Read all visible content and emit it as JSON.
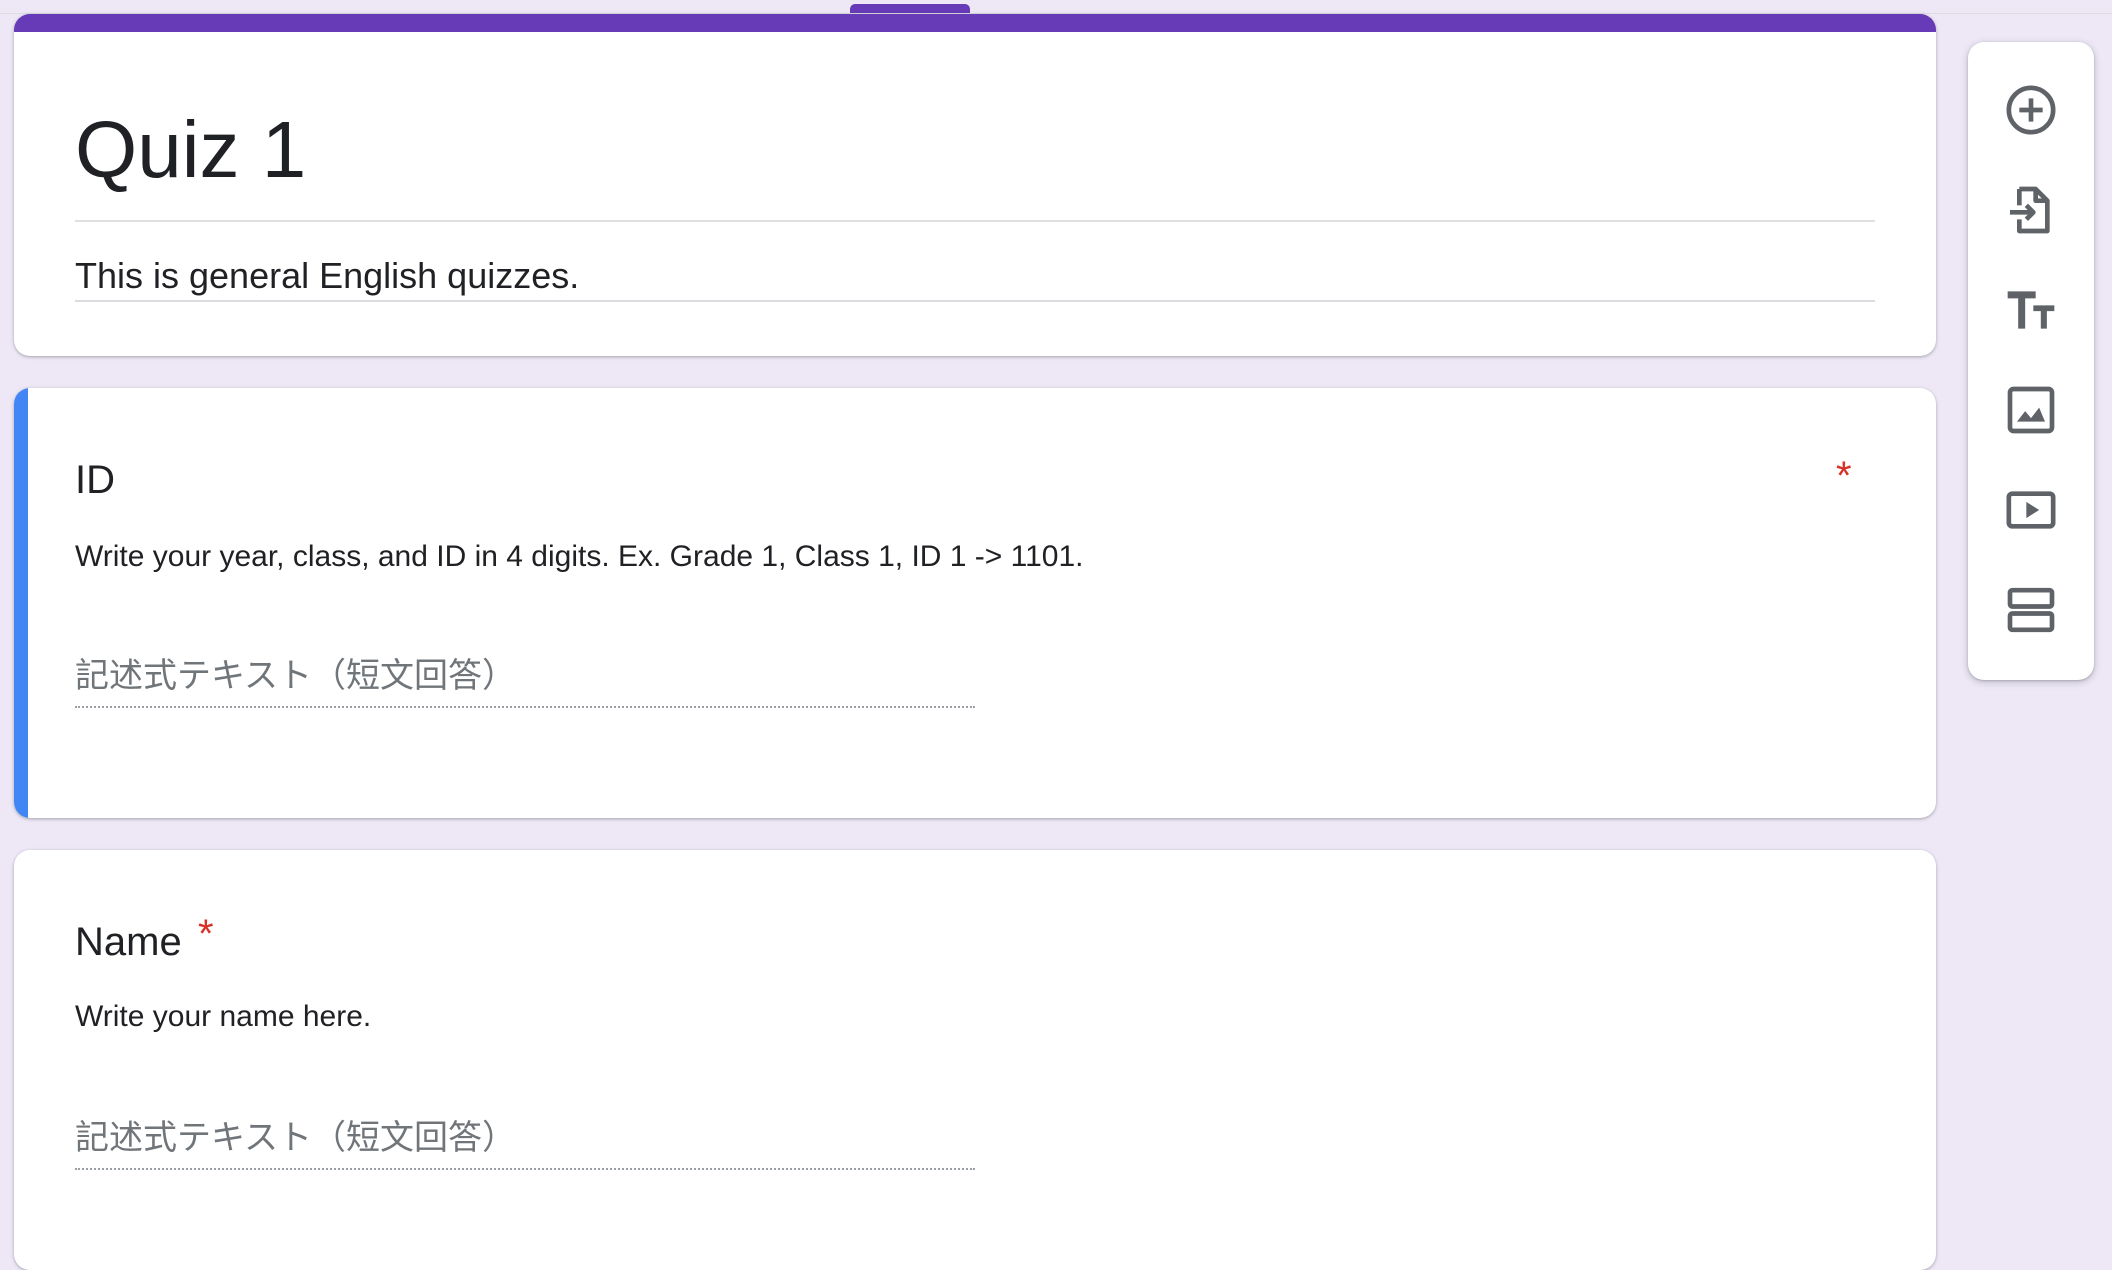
{
  "form": {
    "title": "Quiz 1",
    "description": "This is general English quizzes."
  },
  "questions": [
    {
      "title": "ID",
      "required_mark": "*",
      "help_text": "Write your year, class, and ID in 4 digits. Ex. Grade 1, Class 1, ID 1 -> 1101.",
      "placeholder": "記述式テキスト（短文回答）"
    },
    {
      "title": "Name",
      "required_mark": "*",
      "help_text": "Write your name here.",
      "placeholder": "記述式テキスト（短文回答）"
    }
  ],
  "toolbar": {
    "icons": [
      "add-question-icon",
      "import-questions-icon",
      "add-title-icon",
      "add-image-icon",
      "add-video-icon",
      "add-section-icon"
    ]
  },
  "colors": {
    "theme": "#673ab7",
    "background": "#ede7f6",
    "active_accent": "#4285f4",
    "required": "#d93025"
  }
}
